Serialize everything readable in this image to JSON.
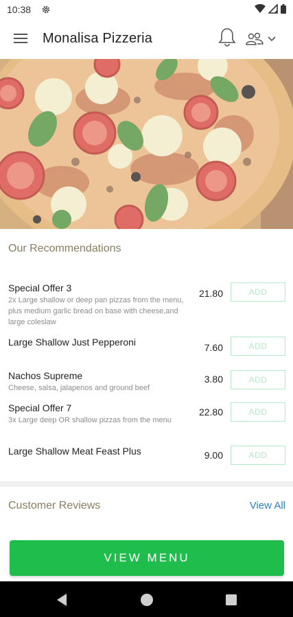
{
  "status_bar": {
    "time": "10:38"
  },
  "app_bar": {
    "title": "Monalisa Pizzeria"
  },
  "recommendations": {
    "title": "Our Recommendations",
    "add_label": "ADD",
    "items": [
      {
        "name": "Special Offer 3",
        "description": "2x Large shallow or deep pan pizzas from the menu, plus medium garlic bread on base with cheese,and large coleslaw",
        "price": "21.80"
      },
      {
        "name": "Large Shallow Just Pepperoni",
        "description": "",
        "price": "7.60"
      },
      {
        "name": "Nachos Supreme",
        "description": "Cheese, salsa, jalapenos and ground beef",
        "price": "3.80"
      },
      {
        "name": "Special Offer 7",
        "description": "3x Large deep OR shallow pizzas from the menu",
        "price": "22.80"
      },
      {
        "name": "Large Shallow Meat Feast Plus",
        "description": "",
        "price": "9.00"
      }
    ]
  },
  "reviews": {
    "title": "Customer Reviews",
    "view_all": "View All"
  },
  "view_menu": {
    "label": "VIEW MENU"
  },
  "colors": {
    "accent_green": "#1fbd4b",
    "link_blue": "#2a7fc9",
    "section_title": "#8a7d5f"
  },
  "icons": [
    "menu-icon",
    "bell-icon",
    "people-icon",
    "chevron-down-icon",
    "settings-icon",
    "wifi-icon",
    "signal-icon",
    "battery-icon",
    "back-icon",
    "home-icon",
    "recents-icon"
  ]
}
